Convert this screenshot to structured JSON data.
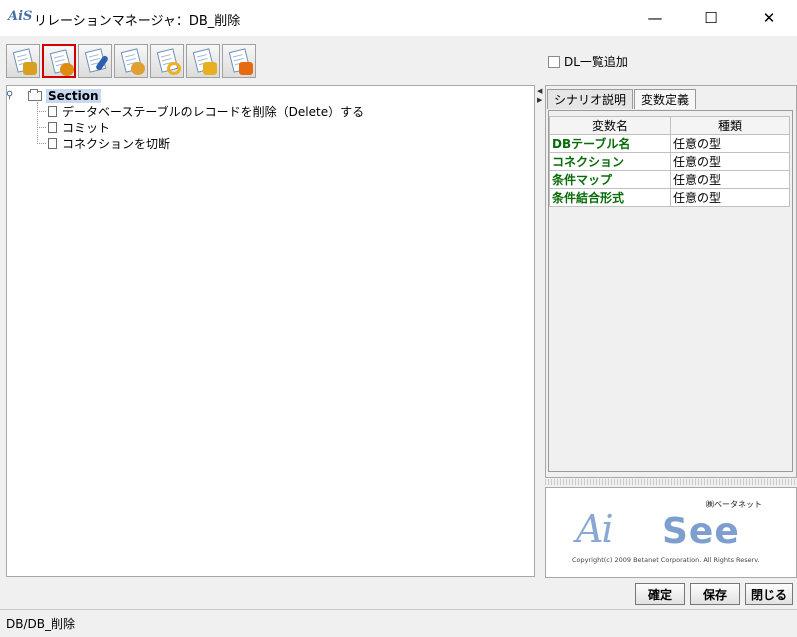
{
  "window": {
    "logo_text": "AiS",
    "title": "リレーションマネージャ：DB_削除",
    "minimize_glyph": "—",
    "maximize_glyph": "☐",
    "close_glyph": "✕"
  },
  "toolbar": {
    "buttons": [
      {
        "icon": "document-edit-icon",
        "badge_color": "#d9a020"
      },
      {
        "icon": "document-settings-icon",
        "badge_color": "#e08a10",
        "active": true
      },
      {
        "icon": "document-pen-icon",
        "badge_color": "#2d5fb0"
      },
      {
        "icon": "document-cut-icon",
        "badge_color": "#e0a030"
      },
      {
        "icon": "document-refresh-icon",
        "badge_color": "#f0b020"
      },
      {
        "icon": "document-export-icon",
        "badge_color": "#e8b020"
      },
      {
        "icon": "document-import-icon",
        "badge_color": "#e86a10"
      }
    ],
    "dl_add_label": "DL一覧追加"
  },
  "tree": {
    "root_label": "Section",
    "children": [
      "データベーステーブルのレコードを削除（Delete）する",
      "コミット",
      "コネクションを切断"
    ]
  },
  "right_panel": {
    "tabs": [
      "シナリオ説明",
      "変数定義"
    ],
    "selected_tab": "変数定義",
    "table": {
      "headers": [
        "変数名",
        "種類"
      ],
      "rows": [
        [
          "DBテーブル名",
          "任意の型"
        ],
        [
          "コネクション",
          "任意の型"
        ],
        [
          "条件マップ",
          "任意の型"
        ],
        [
          "条件結合形式",
          "任意の型"
        ]
      ]
    }
  },
  "logo": {
    "company": "㈱ベータネット",
    "mark": "Ai",
    "name": "See",
    "copyright": "Copyright(c) 2009 Betanet Corporation. All Rights Reserv."
  },
  "buttons": {
    "confirm": "確定",
    "save": "保存",
    "close": "閉じる"
  },
  "status": {
    "text": "DB/DB_削除"
  },
  "colors": {
    "variable_name": "#0a6b0a",
    "selection": "#c8d8f0",
    "active_toolbar_border": "#d10000"
  }
}
